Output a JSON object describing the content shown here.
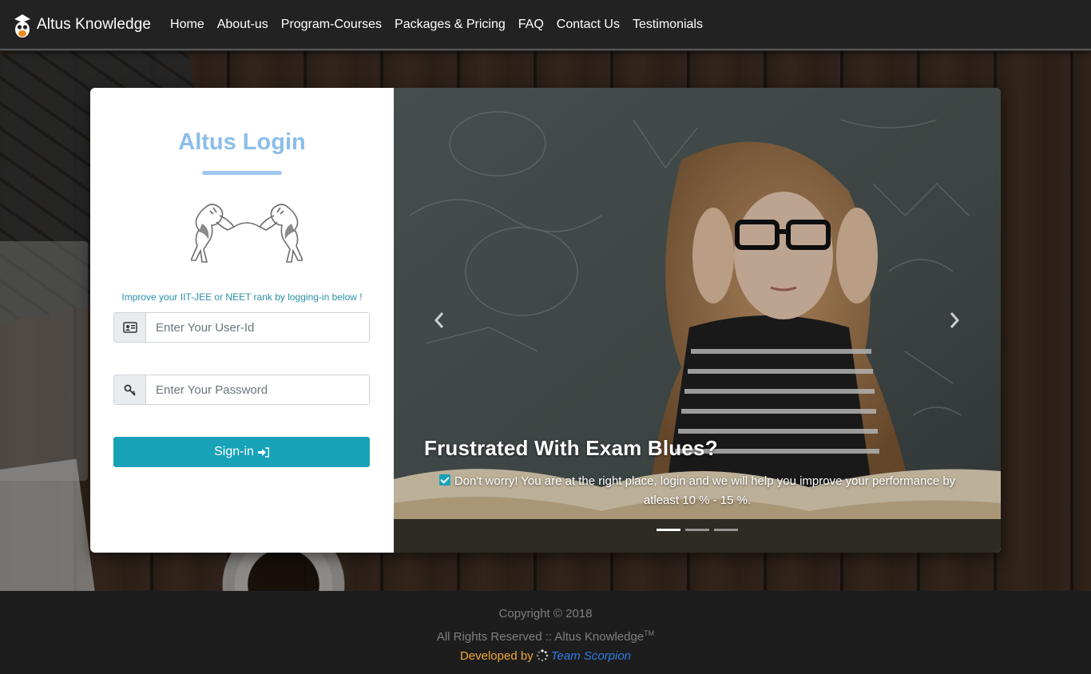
{
  "brand": {
    "name": "Altus Knowledge",
    "logo_icon": "owl-graduate-icon"
  },
  "nav": {
    "links": [
      {
        "label": "Home"
      },
      {
        "label": "About-us"
      },
      {
        "label": "Program-Courses"
      },
      {
        "label": "Packages & Pricing"
      },
      {
        "label": "FAQ"
      },
      {
        "label": "Contact Us"
      },
      {
        "label": "Testimonials"
      }
    ]
  },
  "login": {
    "title": "Altus Login",
    "emblem_icon": "twin-lions-crest-icon",
    "tagline": "Improve your IIT-JEE or NEET rank by logging-in below !",
    "user_id": {
      "placeholder": "Enter Your User-Id",
      "value": "",
      "icon": "id-card-icon"
    },
    "password": {
      "placeholder": "Enter Your Password",
      "value": "",
      "icon": "key-icon"
    },
    "signin_label": "Sign-in",
    "signin_icon": "sign-in-arrow-icon",
    "accent_color": "#8bbde9",
    "button_color": "#17a2b8"
  },
  "carousel": {
    "slide_count": 3,
    "active_index": 0,
    "caption_title": "Frustrated With Exam Blues?",
    "caption_text": "Don't worry! You are at the right place, login and we will help you improve your performance by atleast 10 % - 15 %.",
    "caption_icon": "check-square-icon",
    "prev_icon": "chevron-left-icon",
    "next_icon": "chevron-right-icon"
  },
  "footer": {
    "copyright": "Copyright © 2018",
    "rights_prefix": "All Rights Reserved :: Altus Knowledge",
    "trademark": "TM",
    "developed_by": "Developed by",
    "team_name": "Team Scorpion",
    "spinner_icon": "spinner-icon"
  }
}
